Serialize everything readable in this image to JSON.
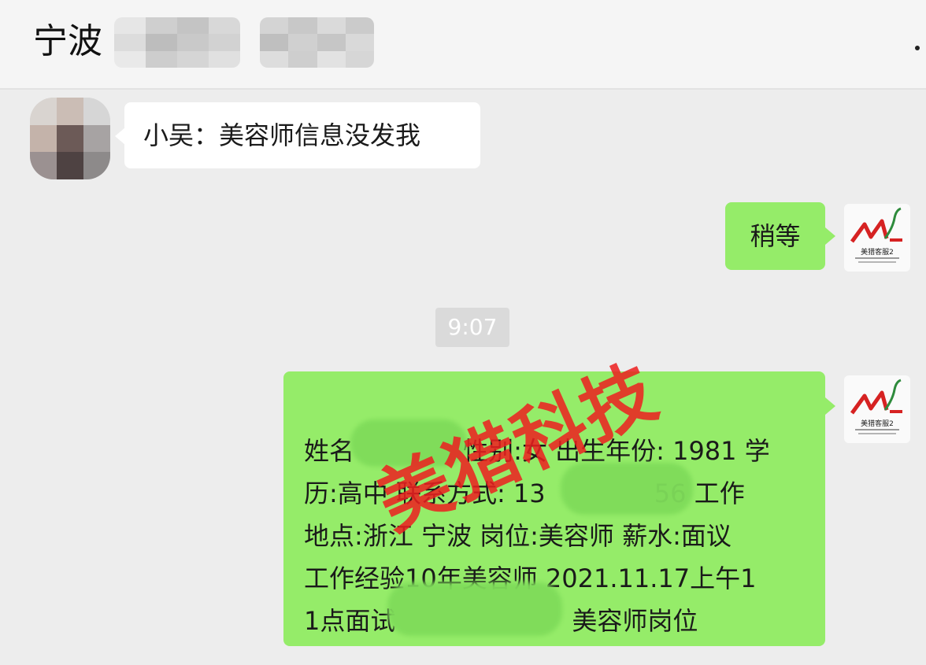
{
  "header": {
    "title": "宁波"
  },
  "messages": [
    {
      "direction": "incoming",
      "text": "小吴：美容师信息没发我"
    },
    {
      "direction": "outgoing",
      "text": "稍等"
    }
  ],
  "timestamp": "9:07",
  "long_message": {
    "direction": "outgoing",
    "lines": [
      "姓名　　　　 性别:女 出生年份: 1981 学",
      "历:高中 联系方式: 13　　　　 56 工作",
      "地点:浙江 宁波 岗位:美容师 薪水:面议",
      "工作经验10年美容师 2021.11.17上午1",
      "1点面试　　　　　　　美容师岗位"
    ]
  },
  "watermark": "美猎科技",
  "logo": {
    "text": "美猎客服2",
    "icon": "meilie-logo-icon"
  },
  "colors": {
    "background": "#ededed",
    "outgoing_bubble": "#95ec69",
    "incoming_bubble": "#ffffff",
    "watermark": "#ec2020"
  }
}
